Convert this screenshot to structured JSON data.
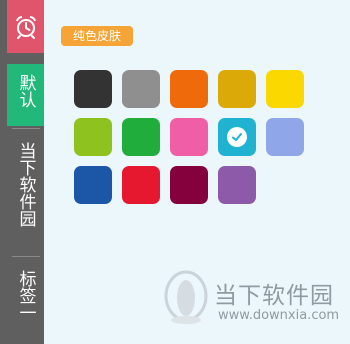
{
  "sidebar": {
    "tabs": [
      {
        "label": "默认",
        "active": true
      },
      {
        "label": "当下软件园",
        "active": false
      },
      {
        "label": "标签一",
        "active": false
      }
    ]
  },
  "panel": {
    "category_label": "纯色皮肤"
  },
  "swatches": [
    {
      "color": "#333333",
      "selected": false
    },
    {
      "color": "#8f8f8f",
      "selected": false
    },
    {
      "color": "#ee6a0b",
      "selected": false
    },
    {
      "color": "#dcaa08",
      "selected": false
    },
    {
      "color": "#fbd800",
      "selected": false
    },
    {
      "color": "#8dc21f",
      "selected": false
    },
    {
      "color": "#21ad3c",
      "selected": false
    },
    {
      "color": "#f05ea7",
      "selected": false
    },
    {
      "color": "#1fb3d1",
      "selected": true
    },
    {
      "color": "#8fa6e8",
      "selected": false
    },
    {
      "color": "#1c56a6",
      "selected": false
    },
    {
      "color": "#e5182f",
      "selected": false
    },
    {
      "color": "#85013d",
      "selected": false
    },
    {
      "color": "#8c5aa8",
      "selected": false
    }
  ],
  "watermark": {
    "brand": "当下软件园",
    "url": "www.downxia.com"
  },
  "colors": {
    "alarm_bg": "#e0556c",
    "active_tab": "#22b87a",
    "sidebar_bg": "#5f5f5f",
    "tag_bg": "#f5a435"
  }
}
